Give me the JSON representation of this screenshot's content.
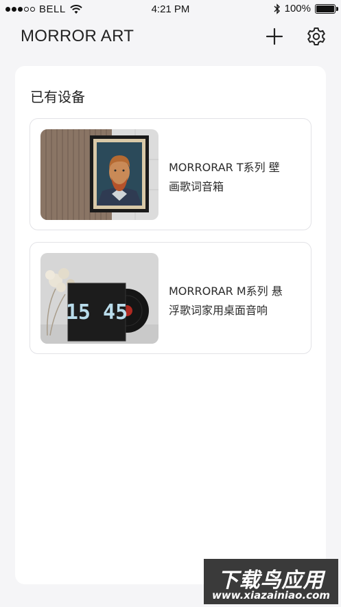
{
  "status_bar": {
    "carrier": "BELL",
    "time": "4:21 PM",
    "battery": "100%"
  },
  "header": {
    "title": "MORROR ART",
    "add_icon": "plus-icon",
    "settings_icon": "gear-icon"
  },
  "main": {
    "section_title": "已有设备",
    "devices": [
      {
        "name_line1": "MORRORAR T系列 壁",
        "name_line2": "画歌词音箱",
        "image": "van-gogh-framed-painting"
      },
      {
        "name_line1": "MORRORAR M系列 悬",
        "name_line2": "浮歌词家用桌面音响",
        "image": "clock-speaker-with-vinyl",
        "clock_text": "15 45"
      }
    ]
  },
  "watermark": {
    "title": "下载鸟应用",
    "url": "www.xiazainiao.com"
  }
}
